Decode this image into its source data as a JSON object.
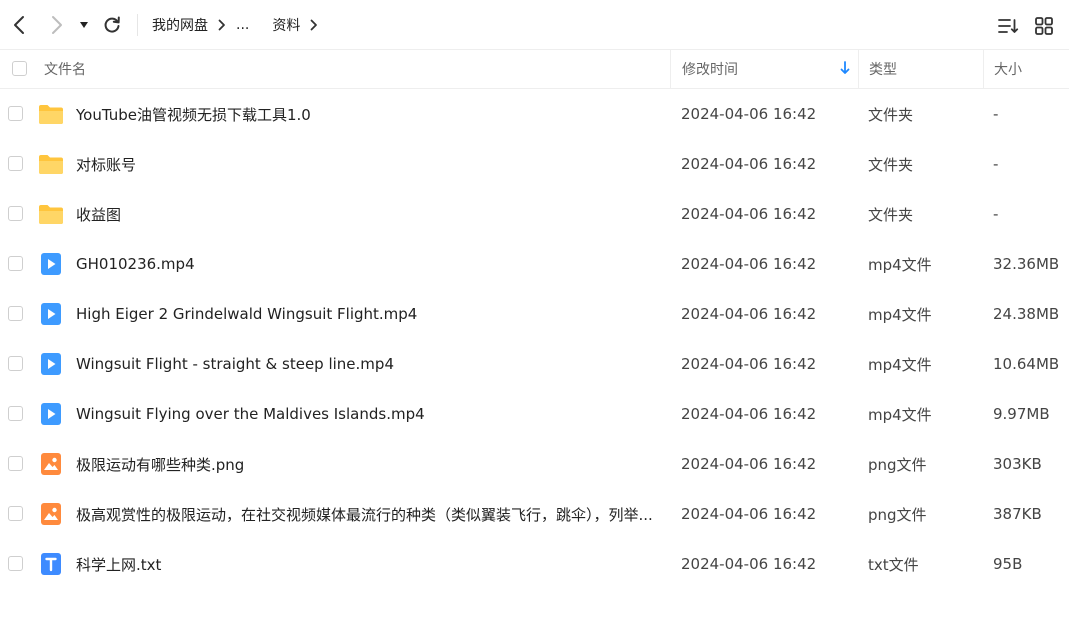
{
  "toolbar": {
    "breadcrumb": [
      {
        "label": "我的网盘"
      },
      {
        "label": "..."
      },
      {
        "label": "资料"
      }
    ]
  },
  "header": {
    "name": "文件名",
    "mtime": "修改时间",
    "type": "类型",
    "size": "大小"
  },
  "colors": {
    "folder": "#FFC53D",
    "video": "#3E9BFF",
    "image": "#FF8A3D",
    "text": "#3E8BFF"
  },
  "files": [
    {
      "icon": "folder-icon",
      "name": "YouTube油管视频无损下载工具1.0",
      "mtime": "2024-04-06 16:42",
      "type": "文件夹",
      "size": "-"
    },
    {
      "icon": "folder-icon",
      "name": "对标账号",
      "mtime": "2024-04-06 16:42",
      "type": "文件夹",
      "size": "-"
    },
    {
      "icon": "folder-icon",
      "name": "收益图",
      "mtime": "2024-04-06 16:42",
      "type": "文件夹",
      "size": "-"
    },
    {
      "icon": "video-file-icon",
      "name": "GH010236.mp4",
      "mtime": "2024-04-06 16:42",
      "type": "mp4文件",
      "size": "32.36MB"
    },
    {
      "icon": "video-file-icon",
      "name": "High Eiger 2 Grindelwald Wingsuit Flight.mp4",
      "mtime": "2024-04-06 16:42",
      "type": "mp4文件",
      "size": "24.38MB"
    },
    {
      "icon": "video-file-icon",
      "name": "Wingsuit Flight - straight & steep line.mp4",
      "mtime": "2024-04-06 16:42",
      "type": "mp4文件",
      "size": "10.64MB"
    },
    {
      "icon": "video-file-icon",
      "name": "Wingsuit Flying over the Maldives Islands.mp4",
      "mtime": "2024-04-06 16:42",
      "type": "mp4文件",
      "size": "9.97MB"
    },
    {
      "icon": "image-file-icon",
      "name": "极限运动有哪些种类.png",
      "mtime": "2024-04-06 16:42",
      "type": "png文件",
      "size": "303KB"
    },
    {
      "icon": "image-file-icon",
      "name": "极高观赏性的极限运动，在社交视频媒体最流行的种类（类似翼装飞行，跳伞），列举...",
      "mtime": "2024-04-06 16:42",
      "type": "png文件",
      "size": "387KB"
    },
    {
      "icon": "text-file-icon",
      "name": "科学上网.txt",
      "mtime": "2024-04-06 16:42",
      "type": "txt文件",
      "size": "95B"
    }
  ]
}
